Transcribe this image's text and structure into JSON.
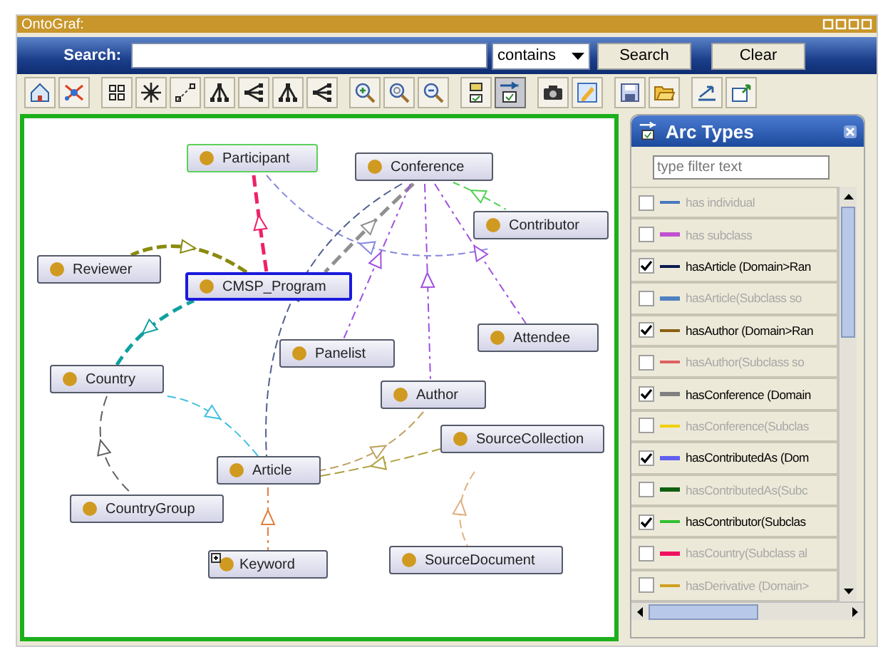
{
  "window": {
    "title": "OntoGraf:"
  },
  "search": {
    "label": "Search:",
    "mode": "contains",
    "buttons": [
      "Search",
      "Clear"
    ]
  },
  "toolbar": [
    [
      {
        "kind": "home",
        "selected": false
      },
      {
        "kind": "scatter",
        "selected": false
      }
    ],
    [
      {
        "kind": "grid",
        "selected": false
      },
      {
        "kind": "radial",
        "selected": false
      },
      {
        "kind": "spring",
        "selected": false
      },
      {
        "kind": "tree-down",
        "selected": false
      },
      {
        "kind": "tree-left",
        "selected": false
      },
      {
        "kind": "tree-down",
        "selected": false
      },
      {
        "kind": "tree-left",
        "selected": false
      }
    ],
    [
      {
        "kind": "zoom-in",
        "selected": false
      },
      {
        "kind": "zoom-reset",
        "selected": false
      },
      {
        "kind": "zoom-out",
        "selected": false
      }
    ],
    [
      {
        "kind": "node-filter",
        "selected": false
      },
      {
        "kind": "arc-filter",
        "selected": true
      }
    ],
    [
      {
        "kind": "camera",
        "selected": false
      },
      {
        "kind": "image",
        "selected": false
      }
    ],
    [
      {
        "kind": "save",
        "selected": false
      },
      {
        "kind": "open",
        "selected": false
      }
    ],
    [
      {
        "kind": "export",
        "selected": false
      },
      {
        "kind": "import",
        "selected": false
      }
    ]
  ],
  "graph": {
    "nodes": [
      {
        "label": "Participant",
        "selected": false,
        "hovered": true,
        "expandable": false
      },
      {
        "label": "Conference",
        "selected": false,
        "hovered": false,
        "expandable": false
      },
      {
        "label": "Contributor",
        "selected": false,
        "hovered": false,
        "expandable": false
      },
      {
        "label": "Reviewer",
        "selected": false,
        "hovered": false,
        "expandable": false
      },
      {
        "label": "CMSP_Program",
        "selected": true,
        "hovered": false,
        "expandable": false
      },
      {
        "label": "Panelist",
        "selected": false,
        "hovered": false,
        "expandable": false
      },
      {
        "label": "Attendee",
        "selected": false,
        "hovered": false,
        "expandable": false
      },
      {
        "label": "Country",
        "selected": false,
        "hovered": false,
        "expandable": false
      },
      {
        "label": "Author",
        "selected": false,
        "hovered": false,
        "expandable": false
      },
      {
        "label": "SourceCollection",
        "selected": false,
        "hovered": false,
        "expandable": false
      },
      {
        "label": "Article",
        "selected": false,
        "hovered": false,
        "expandable": false
      },
      {
        "label": "CountryGroup",
        "selected": false,
        "hovered": false,
        "expandable": false
      },
      {
        "label": "Keyword",
        "selected": false,
        "hovered": false,
        "expandable": true
      },
      {
        "label": "SourceDocument",
        "selected": false,
        "hovered": false,
        "expandable": false
      }
    ]
  },
  "arc_types": {
    "title": "Arc Types",
    "filter_placeholder": "type filter text",
    "items": [
      {
        "label": "has individual",
        "checked": false,
        "color": "#4a78c0"
      },
      {
        "label": "has subclass",
        "checked": false,
        "color": "#c050d0"
      },
      {
        "label": "hasArticle (Domain>Ran",
        "checked": true,
        "color": "#0a1a50"
      },
      {
        "label": "hasArticle(Subclass so",
        "checked": false,
        "color": "#5080c0"
      },
      {
        "label": "hasAuthor (Domain>Ran",
        "checked": true,
        "color": "#8a6010"
      },
      {
        "label": "hasAuthor(Subclass so",
        "checked": false,
        "color": "#e06060"
      },
      {
        "label": "hasConference (Domain",
        "checked": true,
        "color": "#808080"
      },
      {
        "label": "hasConference(Subclas",
        "checked": false,
        "color": "#f0d000"
      },
      {
        "label": "hasContributedAs (Dom",
        "checked": true,
        "color": "#6060f0"
      },
      {
        "label": "hasContributedAs(Subc",
        "checked": false,
        "color": "#106010"
      },
      {
        "label": "hasContributor(Subclas",
        "checked": true,
        "color": "#30c030"
      },
      {
        "label": "hasCountry(Subclass al",
        "checked": false,
        "color": "#f01060"
      },
      {
        "label": "hasDerivative (Domain>",
        "checked": false,
        "color": "#d0a020"
      }
    ]
  }
}
